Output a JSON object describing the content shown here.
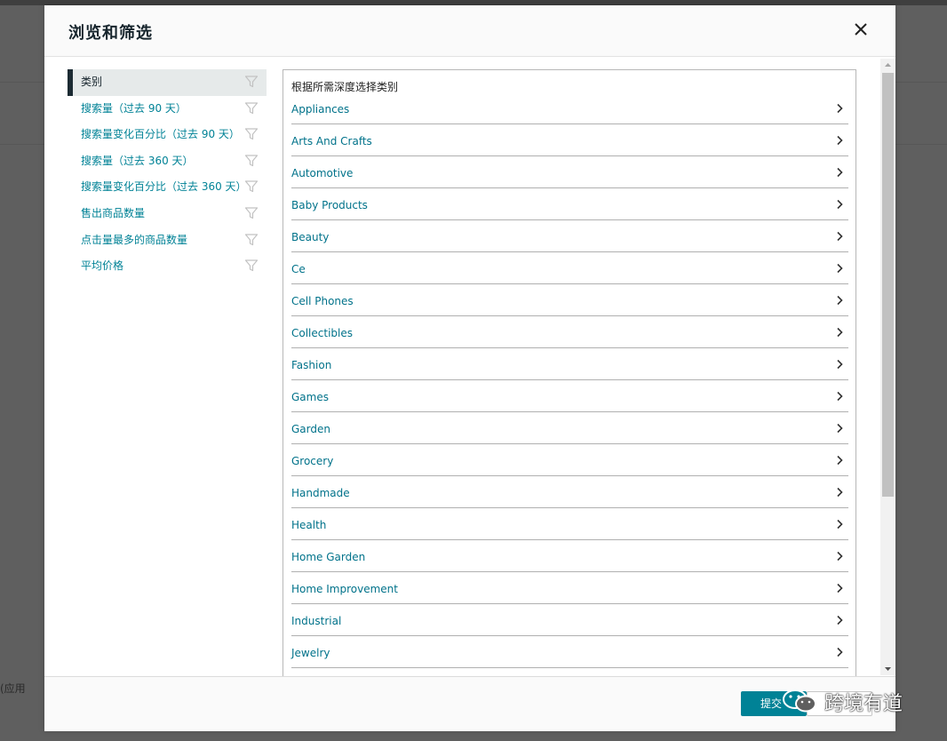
{
  "background": {
    "partial_text": "(应用"
  },
  "modal": {
    "title": "浏览和筛选"
  },
  "left_nav": {
    "items": [
      {
        "label": "类别",
        "active": true
      },
      {
        "label": "搜索量（过去 90 天）",
        "active": false
      },
      {
        "label": "搜索量变化百分比（过去 90 天）",
        "active": false
      },
      {
        "label": "搜索量（过去 360 天）",
        "active": false
      },
      {
        "label": "搜索量变化百分比（过去 360 天）",
        "active": false
      },
      {
        "label": "售出商品数量",
        "active": false
      },
      {
        "label": "点击量最多的商品数量",
        "active": false
      },
      {
        "label": "平均价格",
        "active": false
      }
    ]
  },
  "panel": {
    "heading": "根据所需深度选择类别",
    "categories": [
      "Appliances",
      "Arts And Crafts",
      "Automotive",
      "Baby Products",
      "Beauty",
      "Ce",
      "Cell Phones",
      "Collectibles",
      "Fashion",
      "Games",
      "Garden",
      "Grocery",
      "Handmade",
      "Health",
      "Home Garden",
      "Home Improvement",
      "Industrial",
      "Jewelry"
    ]
  },
  "footer": {
    "submit_label": "提交"
  },
  "watermark": {
    "text": "跨境有道"
  },
  "colors": {
    "accent": "#008296",
    "active_bar": "#1c2b33",
    "overlay": "#5f5f5f"
  },
  "icons": {
    "close": "close-icon",
    "filter": "filter-icon",
    "chevron": "chevron-right-icon"
  }
}
